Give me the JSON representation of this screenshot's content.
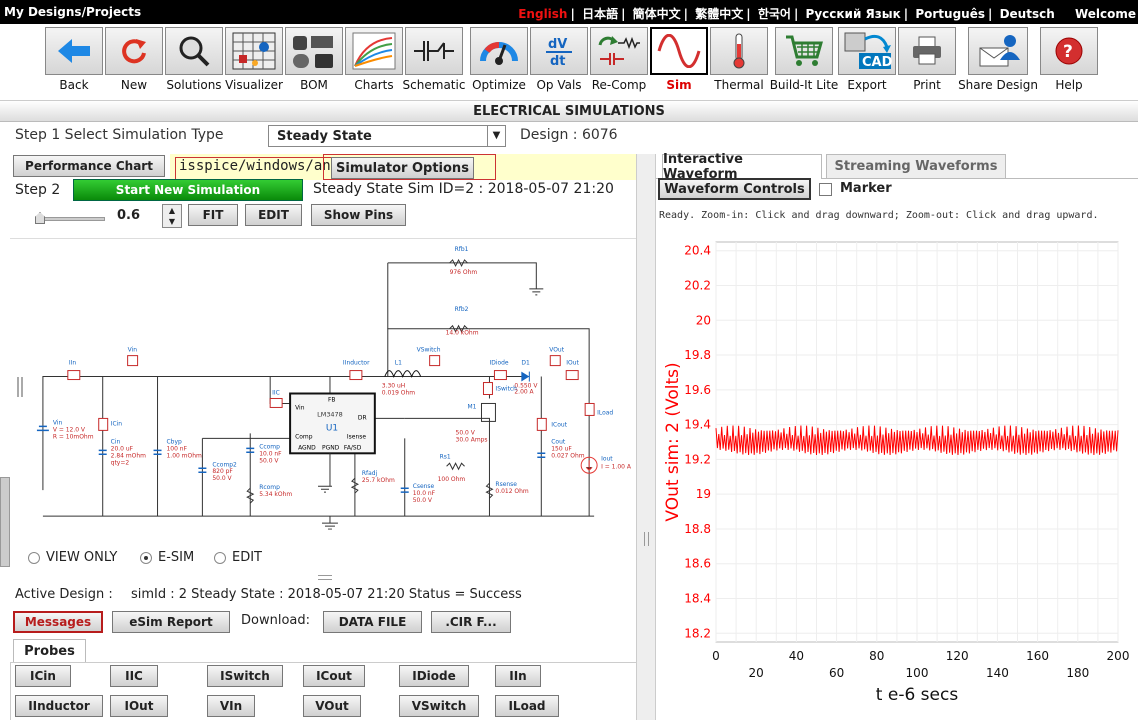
{
  "topbar": {
    "brand": "My Designs/Projects",
    "languages": [
      "English",
      "日本語",
      "簡体中文",
      "繁體中文",
      "한국어",
      "Русский Язык",
      "Português",
      "Deutsch",
      "Welcome"
    ]
  },
  "toolbar": {
    "items": [
      {
        "label": "Back",
        "icon": "back-arrow-icon"
      },
      {
        "label": "New",
        "icon": "refresh-icon"
      },
      {
        "label": "Solutions",
        "icon": "magnifier-icon"
      },
      {
        "label": "Visualizer",
        "icon": "grid-icon"
      },
      {
        "label": "BOM",
        "icon": "components-icon"
      },
      {
        "label": "Charts",
        "icon": "chart-icon"
      },
      {
        "label": "Schematic",
        "icon": "schematic-icon"
      },
      {
        "label": "Optimize",
        "icon": "gauge-icon"
      },
      {
        "label": "Op Vals",
        "icon": "dvdt-icon"
      },
      {
        "label": "Re-Comp",
        "icon": "recomp-icon"
      },
      {
        "label": "Sim",
        "icon": "sine-wave-icon"
      },
      {
        "label": "Thermal",
        "icon": "thermometer-icon"
      },
      {
        "label": "Build-It Lite",
        "icon": "cart-icon"
      },
      {
        "label": "Export",
        "icon": "cad-icon"
      },
      {
        "label": "Print",
        "icon": "printer-icon"
      },
      {
        "label": "Share Design",
        "icon": "share-icon"
      },
      {
        "label": "Help",
        "icon": "help-icon"
      }
    ]
  },
  "section_title": "ELECTRICAL SIMULATIONS",
  "step1": {
    "label": "Step 1  Select Simulation Type",
    "select_value": "Steady State",
    "design": "Design : 6076"
  },
  "row2": {
    "perf_chart": "Performance Chart",
    "path": "isspice/windows/any",
    "sim_options": "Simulator Options"
  },
  "step2": {
    "label": "Step 2",
    "start": "Start New Simulation",
    "sim_id": "Steady State Sim ID=2 : 2018-05-07 21:20"
  },
  "zoom": {
    "value": "0.6",
    "fit": "FIT",
    "edit": "EDIT",
    "show_pins": "Show Pins"
  },
  "schematic": {
    "chip_name": "LM3478",
    "chip_ref": "U1",
    "labels": [
      "Rfb1",
      "976 Ohm",
      "Rfb2",
      "14.0 kOhm",
      "Vin",
      "IIn",
      "IInductor",
      "L1",
      "3.30 uH",
      "0.019 Ohm",
      "VSwitch",
      "IDiode",
      "D1",
      "0.550 V",
      "2.00 A",
      "VOut",
      "IOut",
      "ILoad",
      "IIC",
      "Vin",
      "FB",
      "DR",
      "Comp",
      "Isense",
      "AGND",
      "PGND",
      "FA/SD",
      "ISwitch",
      "M1",
      "50.0 V",
      "30.0 Amps",
      "ICout",
      "Cout",
      "150 uF",
      "0.027 Ohm",
      "Iout",
      "I = 1.00 A",
      "Vin",
      "V = 12.0 V",
      "R = 10mOhm",
      "ICin",
      "Cin",
      "20.0 uF",
      "2.84 mOhm",
      "qty=2",
      "Cbyp",
      "100 nF",
      "1.00 mOhm",
      "Ccomp",
      "10.0 nF",
      "50.0 V",
      "Ccomp2",
      "820 pF",
      "50.0 V",
      "Rcomp",
      "5.34 kOhm",
      "Rfadj",
      "25.7 kOhm",
      "Rs1",
      "100 Ohm",
      "Csense",
      "10.0 nF",
      "50.0 V",
      "Rsense",
      "0.012 Ohm"
    ]
  },
  "mode": {
    "options": [
      "VIEW ONLY",
      "E-SIM",
      "EDIT"
    ],
    "selected": "E-SIM"
  },
  "active_design": {
    "label": "Active Design :",
    "value": "simId : 2 Steady State : 2018-05-07 21:20 Status = Success"
  },
  "actions": {
    "messages": "Messages",
    "esim_report": "eSim Report",
    "download": "Download:",
    "data_file": "DATA FILE",
    "cir_file": ".CIR F..."
  },
  "probes": {
    "tab": "Probes",
    "items": [
      "ICin",
      "IIC",
      "ISwitch",
      "ICout",
      "IDiode",
      "IIn",
      "IInductor",
      "IOut",
      "VIn",
      "VOut",
      "VSwitch",
      "ILoad"
    ]
  },
  "right": {
    "tabs": [
      "Interactive Waveform",
      "Streaming Waveforms"
    ],
    "waveform_controls": "Waveform Controls",
    "marker": "Marker",
    "status": "Ready.  Zoom-in: Click and drag downward; Zoom-out: Click and drag upward."
  },
  "chart_data": {
    "type": "line",
    "series": [
      {
        "name": "VOut sim: 2",
        "color": "#ff0000"
      }
    ],
    "xlabel": "t e-6 secs",
    "ylabel": "VOut sim:  2 (Volts)",
    "xlim": [
      0,
      200
    ],
    "ylim": [
      18.15,
      20.45
    ],
    "x_ticks_top": [
      0,
      40,
      80,
      120,
      160,
      200
    ],
    "x_ticks_bottom": [
      20,
      60,
      100,
      140,
      180
    ],
    "y_ticks": [
      20.4,
      20.2,
      20,
      19.8,
      19.6,
      19.4,
      19.2,
      19,
      18.8,
      18.6,
      18.4,
      18.2
    ],
    "ripple": {
      "center": 19.31,
      "min": 19.23,
      "max": 19.4,
      "periods": 71
    },
    "grid": true
  }
}
